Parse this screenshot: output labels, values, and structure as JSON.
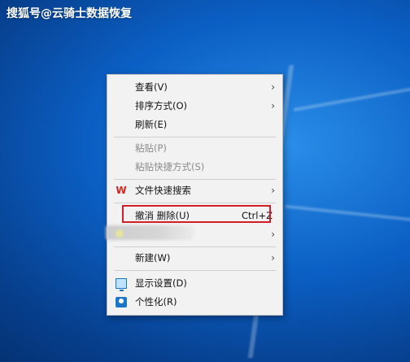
{
  "watermark": "搜狐号@云骑士数据恢复",
  "menu": {
    "view": "查看(V)",
    "sort": "排序方式(O)",
    "refresh": "刷新(E)",
    "paste": "粘贴(P)",
    "paste_shortcut": "粘贴快捷方式(S)",
    "file_search": "文件快速搜索",
    "undo_delete": "撤消 删除(U)",
    "undo_shortcut": "Ctrl+Z",
    "new": "新建(W)",
    "display_settings": "显示设置(D)",
    "personalize": "个性化(R)",
    "wps_icon_text": "W",
    "arrow": "›"
  },
  "colors": {
    "highlight_border": "#d11f2a",
    "menu_bg": "#f2f2f2",
    "desktop_blue": "#0b5fc4"
  },
  "icons": [
    "wps-icon",
    "display-settings-icon",
    "personalize-icon",
    "submenu-arrow-icon"
  ]
}
